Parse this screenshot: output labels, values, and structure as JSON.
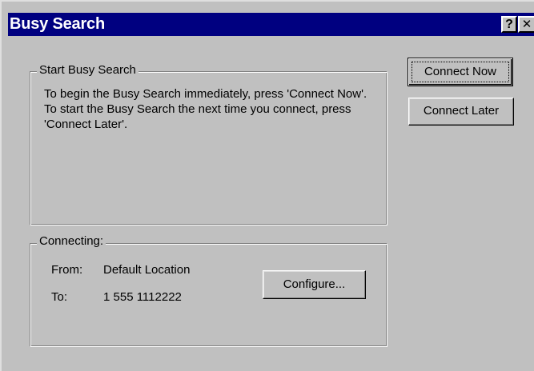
{
  "window": {
    "title": "Busy Search",
    "help_glyph": "?",
    "close_glyph": "✕"
  },
  "start_group": {
    "legend": "Start Busy Search",
    "description": "To begin the Busy Search immediately, press 'Connect Now'.  To start the Busy Search the next time you connect, press 'Connect Later'."
  },
  "connecting_group": {
    "legend": "Connecting:",
    "from_label": "From:",
    "from_value": "Default Location",
    "to_label": "To:",
    "to_value": "1 555 1112222"
  },
  "buttons": {
    "connect_now": "Connect Now",
    "connect_later": "Connect Later",
    "configure": "Configure..."
  },
  "colors": {
    "title_bar": "#000080",
    "face": "#c0c0c0"
  }
}
